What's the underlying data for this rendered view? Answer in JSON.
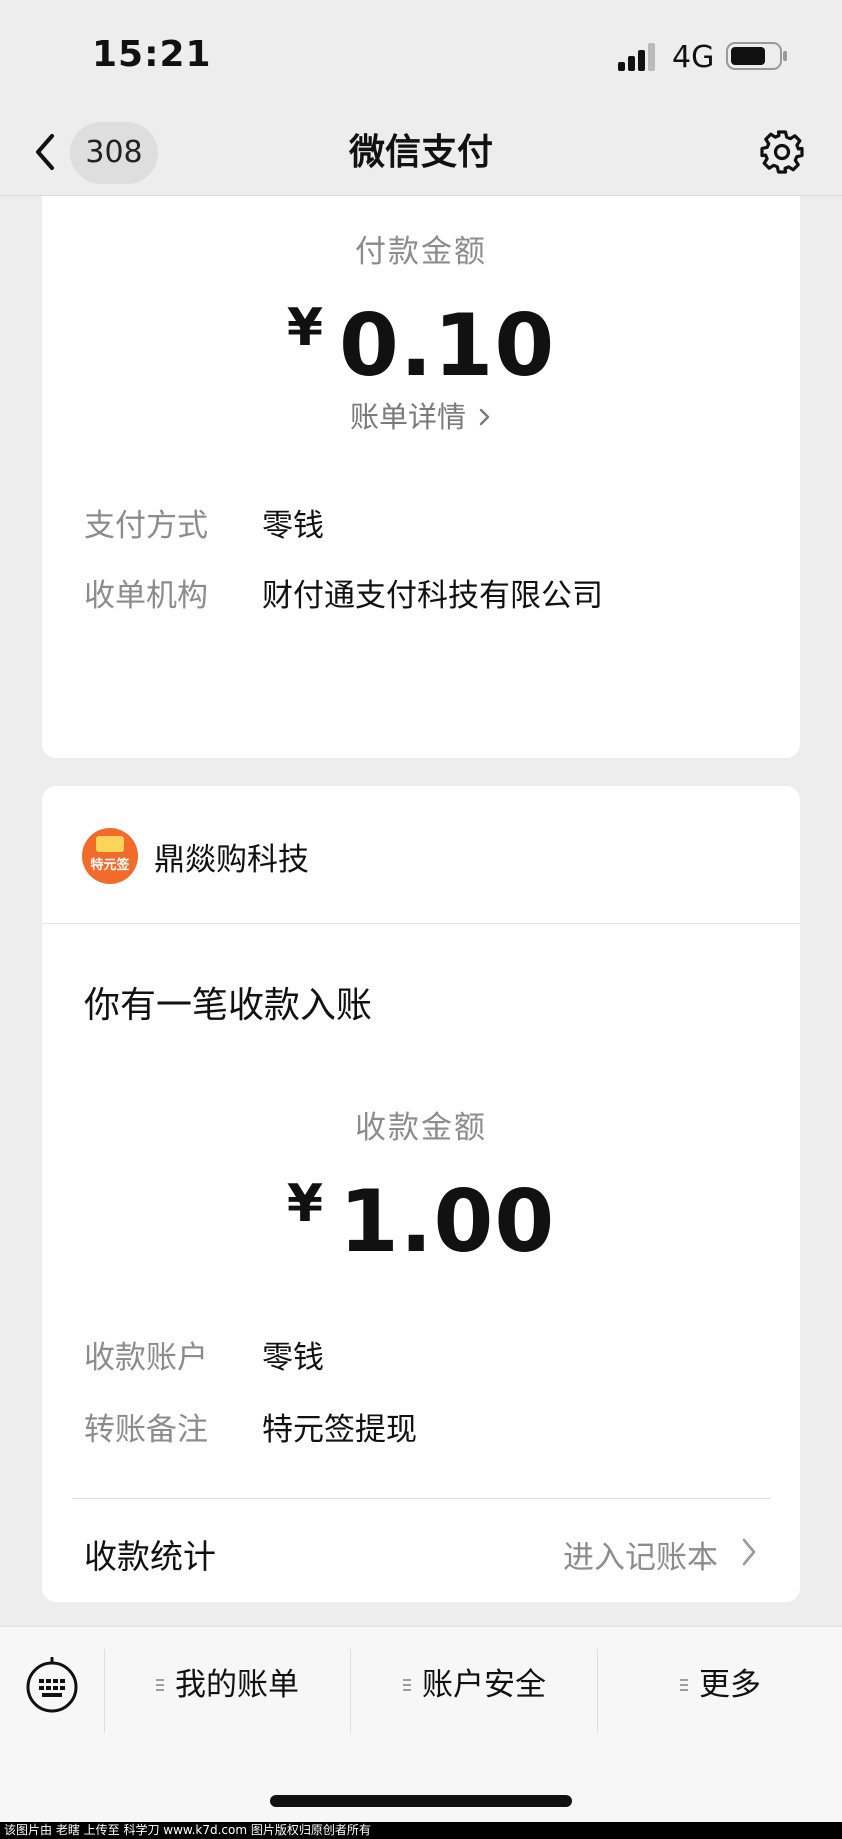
{
  "status_bar": {
    "time": "15:21",
    "network": "4G"
  },
  "nav": {
    "back_count": "308",
    "title": "微信支付"
  },
  "payment_card": {
    "amount_label": "付款金额",
    "currency": "¥",
    "amount": "0.10",
    "detail_link": "账单详情",
    "rows": [
      {
        "key": "支付方式",
        "value": "零钱"
      },
      {
        "key": "收单机构",
        "value": "财付通支付科技有限公司"
      }
    ]
  },
  "receipt_card": {
    "merchant_name": "鼎燚购科技",
    "logo_text": "特元签",
    "notice_title": "你有一笔收款入账",
    "amount_label": "收款金额",
    "currency": "¥",
    "amount": "1.00",
    "rows": [
      {
        "key": "收款账户",
        "value": "零钱"
      },
      {
        "key": "转账备注",
        "value": "特元签提现"
      }
    ],
    "stats_label": "收款统计",
    "stats_link": "进入记账本"
  },
  "bottom_menu": {
    "items": [
      "我的账单",
      "账户安全",
      "更多"
    ]
  },
  "watermark": "该图片由 老瞎 上传至 科学刀 www.k7d.com 图片版权归原创者所有",
  "colors": {
    "accent": "#f26b2a",
    "text": "#111111",
    "muted": "#8c8c8c",
    "background": "#ededed"
  }
}
